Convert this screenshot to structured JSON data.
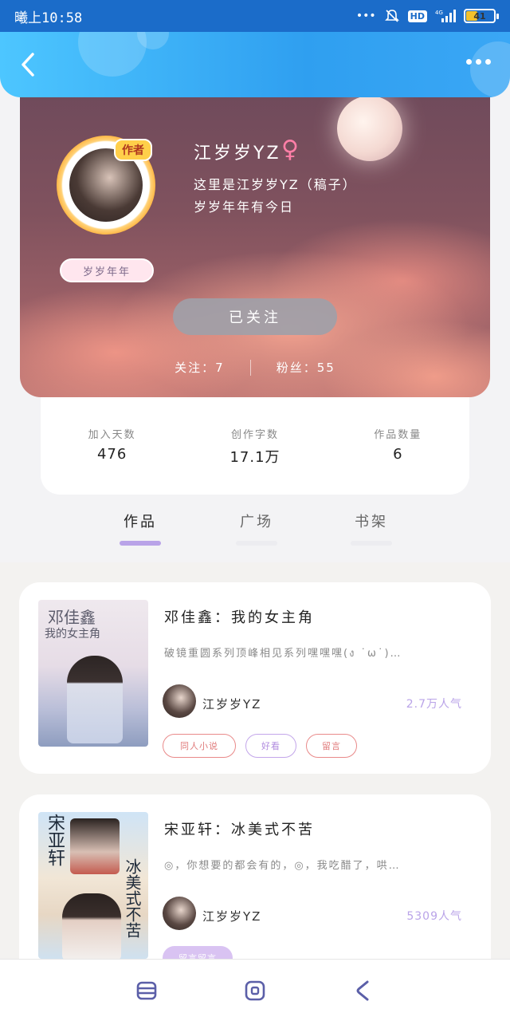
{
  "status_bar": {
    "time": "曦上10:58",
    "icons": [
      "dots-icon",
      "mute-icon",
      "hd-icon",
      "signal-icon",
      "battery-icon"
    ],
    "hd_label": "HD",
    "network_label": "4G",
    "battery_level": "41"
  },
  "header": {
    "back_icon": "chevron-left-icon",
    "more_icon": "more-dots-icon",
    "accent_color": "#2f9ff0"
  },
  "profile": {
    "author_tag": "作者",
    "badge": "岁岁年年",
    "name": "江岁岁YZ",
    "gender_symbol": "♀",
    "bio_line1": "这里是江岁岁YZ（稿子）",
    "bio_line2": "岁岁年年有今日",
    "follow_button": "已关注",
    "following_text": "关注：7",
    "fans_text": "粉丝：55"
  },
  "stats": [
    {
      "label": "加入天数",
      "value": "476"
    },
    {
      "label": "创作字数",
      "value": "17.1万"
    },
    {
      "label": "作品数量",
      "value": "6"
    }
  ],
  "tabs": [
    {
      "label": "作品",
      "active": true
    },
    {
      "label": "广场",
      "active": false
    },
    {
      "label": "书架",
      "active": false
    }
  ],
  "works": [
    {
      "title": "邓佳鑫：我的女主角",
      "desc": "破镜重圆系列顶峰相见系列嘿嘿嘿(ง ˙ω˙)…",
      "cover_title": "邓佳鑫",
      "cover_subtitle": "我的女主角",
      "author": "江岁岁YZ",
      "popularity": "2.7万人气",
      "tags": [
        "同人小说",
        "好看",
        "留言"
      ]
    },
    {
      "title": "宋亚轩：冰美式不苦",
      "desc": "◎，你想要的都会有的，◎，我吃醋了，哄…",
      "cover_title": "宋亚轩",
      "cover_subtitle": "冰美式不苦",
      "author": "江岁岁YZ",
      "popularity": "5309人气",
      "tags": [
        "留言留言"
      ]
    }
  ],
  "bottom_nav": {
    "icons": [
      "menu-icon",
      "home-square-icon",
      "back-icon"
    ]
  }
}
